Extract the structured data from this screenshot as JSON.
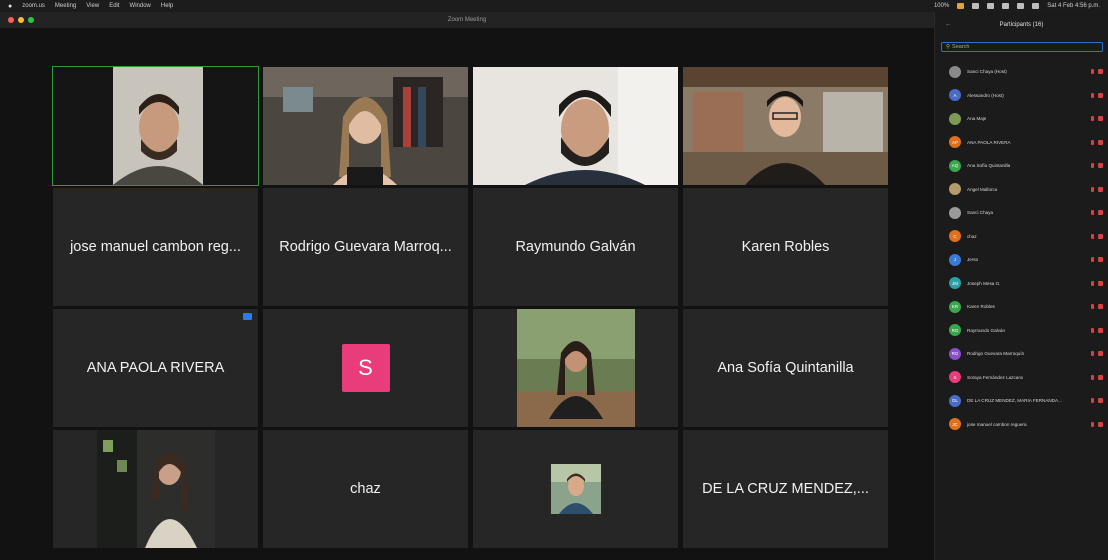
{
  "menubar": {
    "items": [
      "zoom.us",
      "Meeting",
      "View",
      "Edit",
      "Window",
      "Help"
    ],
    "right_text": "Sat 4 Feb 4:56 p.m.",
    "zoom_level": "100%"
  },
  "window": {
    "title": "Zoom Meeting"
  },
  "gallery": {
    "tiles": [
      {
        "name": "",
        "type": "video"
      },
      {
        "name": "",
        "type": "video"
      },
      {
        "name": "",
        "type": "video"
      },
      {
        "name": "",
        "type": "video"
      },
      {
        "name": "jose manuel cambon reg..."
      },
      {
        "name": "Rodrigo Guevara Marroq..."
      },
      {
        "name": "Raymundo Galván"
      },
      {
        "name": "Karen Robles"
      },
      {
        "name": "ANA PAOLA RIVERA"
      },
      {
        "initial": "S"
      },
      {
        "name": "",
        "type": "video"
      },
      {
        "name": "Ana Sofía Quintanilla"
      },
      {
        "name": "",
        "type": "video"
      },
      {
        "name": "chaz"
      },
      {
        "name": "",
        "type": "video"
      },
      {
        "name": "DE LA CRUZ MENDEZ,..."
      }
    ]
  },
  "participants": {
    "title": "Participants (16)",
    "search_placeholder": "Search",
    "list": [
      {
        "name": "Sanci Chaya (Host)",
        "initials": "",
        "color": "#8a8a8a"
      },
      {
        "name": "Alessandro (Host)",
        "initials": "A",
        "color": "#4a6cc7"
      },
      {
        "name": "Ana Maje",
        "initials": "",
        "color": "#7d9b55"
      },
      {
        "name": "ANA PAOLA RIVERA",
        "initials": "AP",
        "color": "#e0701c"
      },
      {
        "name": "Ana Sofía Quintanilla",
        "initials": "AQ",
        "color": "#3aa64d"
      },
      {
        "name": "Angel Mallorca",
        "initials": "",
        "color": "#b39a6a"
      },
      {
        "name": "Sanci Chaya",
        "initials": "",
        "color": "#9a9a9a"
      },
      {
        "name": "chaz",
        "initials": "C",
        "color": "#e0701c"
      },
      {
        "name": "Jerso",
        "initials": "J",
        "color": "#3a7bd5"
      },
      {
        "name": "Joseph Mesa G.",
        "initials": "JM",
        "color": "#2d9fa8"
      },
      {
        "name": "Karen Robles",
        "initials": "KR",
        "color": "#3aa64d"
      },
      {
        "name": "Raymundo Galván",
        "initials": "RG",
        "color": "#3aa64d"
      },
      {
        "name": "Rodrigo Guevara Marroquín",
        "initials": "RG",
        "color": "#8a4fc7"
      },
      {
        "name": "Soraya Fernández Lazcano",
        "initials": "S",
        "color": "#e83c7b"
      },
      {
        "name": "DE LA CRUZ MENDEZ, MARIA FERNANDA...",
        "initials": "DL",
        "color": "#4a6cc7"
      },
      {
        "name": "jose manuel cambon reguera",
        "initials": "JC",
        "color": "#e0701c"
      }
    ]
  }
}
